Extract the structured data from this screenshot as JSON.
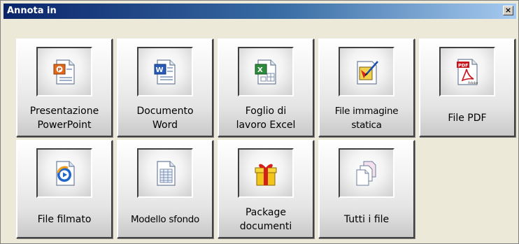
{
  "window": {
    "title": "Annota in",
    "close_label": "×"
  },
  "tiles": [
    {
      "label": "Presentazione\nPowerPoint",
      "icon": "powerpoint-document-icon"
    },
    {
      "label": "Documento\nWord",
      "icon": "word-document-icon"
    },
    {
      "label": "Foglio di\nlavoro Excel",
      "icon": "excel-worksheet-icon"
    },
    {
      "label": "File immagine\nstatica",
      "icon": "static-image-file-icon"
    },
    {
      "label": "File PDF",
      "icon": "pdf-file-icon"
    },
    {
      "label": "File filmato",
      "icon": "movie-file-icon"
    },
    {
      "label": "Modello sfondo",
      "icon": "background-template-icon"
    },
    {
      "label": "Package\ndocumenti",
      "icon": "gift-package-icon"
    },
    {
      "label": "Tutti i file",
      "icon": "all-files-icon"
    }
  ],
  "colors": {
    "titlebar_start": "#0a246a",
    "titlebar_end": "#a6caf0",
    "window_bg": "#ece9d8"
  }
}
